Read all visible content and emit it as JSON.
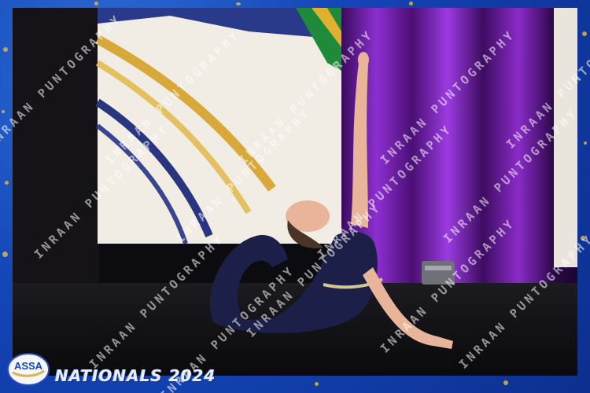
{
  "watermark": {
    "text": "INRAAN PUNTOGRAPHY",
    "logo_text": "ASSA"
  },
  "event": {
    "title": "NATIONALS 2024"
  },
  "colors": {
    "frame_blue": "#1446b8",
    "gold_speckle": "#d9b44a",
    "curtain_purple": "#7a1fb0",
    "costume_navy": "#1c2048"
  }
}
